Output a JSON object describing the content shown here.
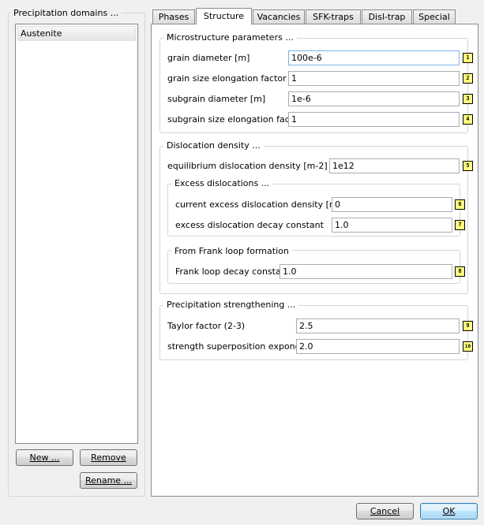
{
  "left_panel": {
    "title": "Precipitation domains ...",
    "items": [
      "Austenite"
    ],
    "new_label": "New ...",
    "remove_label": "Remove",
    "rename_label": "Rename ..."
  },
  "tabs": [
    "Phases",
    "Structure",
    "Vacancies",
    "SFK-traps",
    "Disl-trap",
    "Special"
  ],
  "active_tab": "Structure",
  "microstructure": {
    "title": "Microstructure parameters ...",
    "rows": [
      {
        "label": "grain diameter [m]",
        "value": "100e-6",
        "badge": "1"
      },
      {
        "label": "grain size elongation factor",
        "value": "1",
        "badge": "2"
      },
      {
        "label": "subgrain diameter [m]",
        "value": "1e-6",
        "badge": "3"
      },
      {
        "label": "subgrain size elongation factor",
        "value": "1",
        "badge": "4"
      }
    ]
  },
  "dislocation": {
    "title": "Dislocation density ...",
    "equilibrium": {
      "label": "equilibrium dislocation density [m-2]",
      "value": "1e12",
      "badge": "5"
    },
    "excess": {
      "title": "Excess dislocations ...",
      "rows": [
        {
          "label": "current excess dislocation density [m-2]",
          "value": "0",
          "badge": "6"
        },
        {
          "label": "excess dislocation decay constant",
          "value": "1.0",
          "badge": "7"
        }
      ]
    },
    "frank": {
      "title": "From Frank loop formation",
      "row": {
        "label": "Frank loop decay constant",
        "value": "1.0",
        "badge": "8"
      }
    }
  },
  "strengthening": {
    "title": "Precipitation strengthening ...",
    "rows": [
      {
        "label": "Taylor factor (2-3)",
        "value": "2.5",
        "badge": "9"
      },
      {
        "label": "strength superposition exponent",
        "value": "2.0",
        "badge": "10"
      }
    ]
  },
  "footer": {
    "cancel_label": "Cancel",
    "ok_label": "OK"
  }
}
